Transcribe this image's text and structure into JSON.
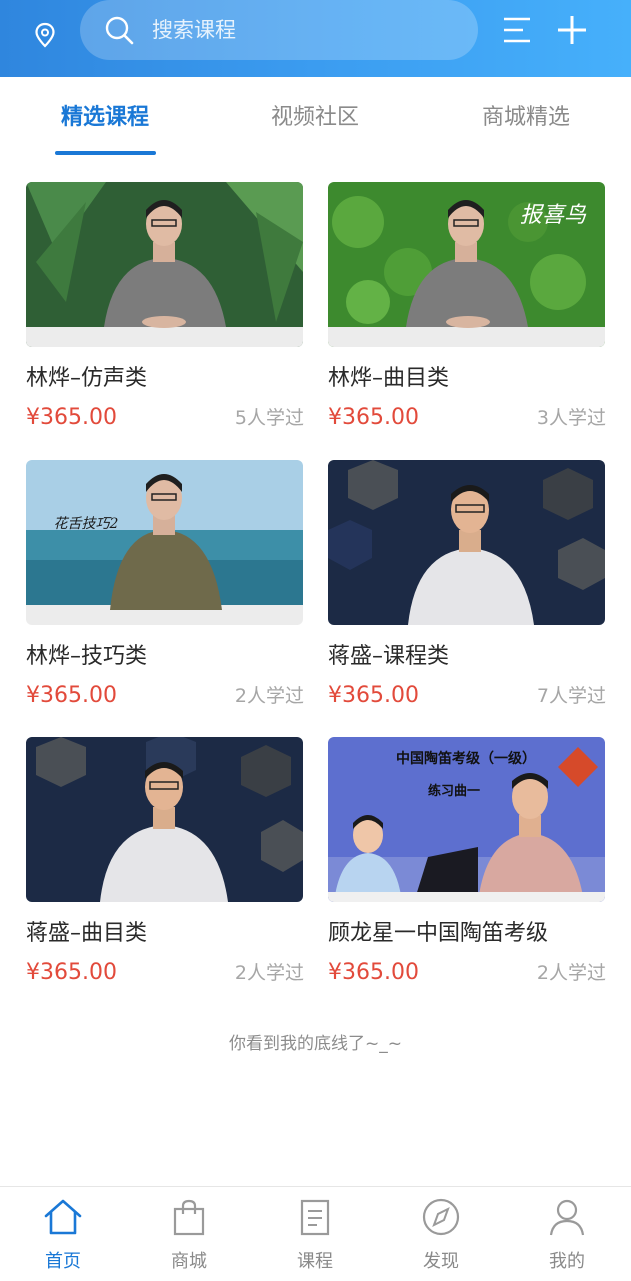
{
  "header": {
    "search_placeholder": "搜索课程",
    "icons": {
      "location": "location-pin-icon",
      "search": "search-icon",
      "menu": "menu-icon",
      "add": "plus-icon"
    }
  },
  "tabs": [
    {
      "label": "精选课程",
      "active": true
    },
    {
      "label": "视频社区",
      "active": false
    },
    {
      "label": "商城精选",
      "active": false
    }
  ],
  "courses": [
    {
      "title": "林烨–仿声类",
      "price": "¥365.00",
      "learners": "5人学过",
      "thumb_overlay": ""
    },
    {
      "title": "林烨–曲目类",
      "price": "¥365.00",
      "learners": "3人学过",
      "thumb_overlay": "报喜鸟"
    },
    {
      "title": "林烨–技巧类",
      "price": "¥365.00",
      "learners": "2人学过",
      "thumb_overlay": "花舌技巧2"
    },
    {
      "title": "蒋盛–课程类",
      "price": "¥365.00",
      "learners": "7人学过",
      "thumb_overlay": ""
    },
    {
      "title": "蒋盛–曲目类",
      "price": "¥365.00",
      "learners": "2人学过",
      "thumb_overlay": ""
    },
    {
      "title": "顾龙星一中国陶笛考级",
      "price": "¥365.00",
      "learners": "2人学过",
      "thumb_overlay": "中国陶笛考级（一级）",
      "thumb_overlay_2": "练习曲一"
    }
  ],
  "footer_text": "你看到我的底线了~_~",
  "bottom_nav": [
    {
      "label": "首页",
      "icon": "home-icon",
      "active": true
    },
    {
      "label": "商城",
      "icon": "shopping-bag-icon",
      "active": false
    },
    {
      "label": "课程",
      "icon": "book-icon",
      "active": false
    },
    {
      "label": "发现",
      "icon": "compass-icon",
      "active": false
    },
    {
      "label": "我的",
      "icon": "user-icon",
      "active": false
    }
  ],
  "colors": {
    "header_start": "#2f86de",
    "header_end": "#46b0fb",
    "accent": "#1a78d6",
    "price": "#e24a3b"
  }
}
